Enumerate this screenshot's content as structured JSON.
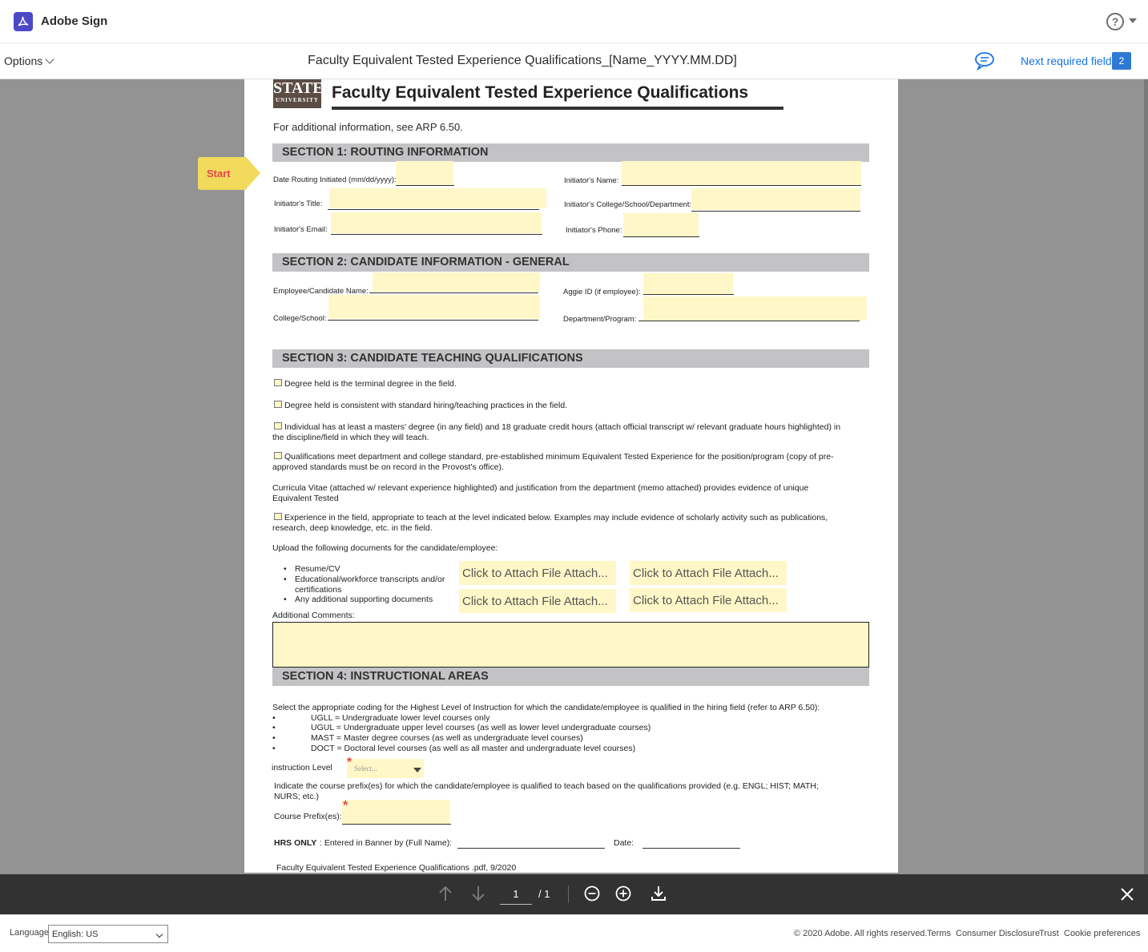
{
  "app": {
    "brand": "Adobe Sign"
  },
  "optionsBar": {
    "options_label": "Options",
    "doc_title": "Faculty Equivalent Tested Experience Qualifications_[Name_YYYY.MM.DD]",
    "next_field_label": "Next required field",
    "next_field_count": "2"
  },
  "form": {
    "logo_big": "STATE",
    "logo_small": "UNIVERSITY",
    "title": "Faculty Equivalent Tested Experience Qualifications",
    "additional_info": "For additional information, see ARP 6.50.",
    "start_tag": "Start",
    "section1": {
      "title": "SECTION 1: ROUTING INFORMATION",
      "date_label": "Date Routing Initiated (mm/dd/yyyy):",
      "initiator_name": "Initiator's Name:",
      "initiator_title": "Initiator's Title:",
      "initiator_college": "Initiator's College/School/Department:",
      "initiator_email": "Initiator's Email:",
      "initiator_phone": "Initiator's Phone:"
    },
    "section2": {
      "title": "SECTION 2: CANDIDATE INFORMATION - GENERAL",
      "candidate_name": "Employee/Candidate Name:",
      "aggie_id": "Aggie ID (if employee):",
      "college": "College/School:",
      "department": "Department/Program:"
    },
    "section3": {
      "title": "SECTION 3: CANDIDATE TEACHING QUALIFICATIONS",
      "opt1": "Degree held is the terminal degree in the field.",
      "opt2": "Degree held is consistent with standard hiring/teaching practices in the field.",
      "opt3a": "Individual has at least a masters' degree (in any field) and 18 graduate credit hours (attach official transcript w/ relevant graduate hours highlighted) in",
      "opt3b": "the discipline/field in which they will teach.",
      "opt4a": "Qualifications meet department and college standard, pre-established minimum Equivalent Tested Experience for the position/program (copy of pre-",
      "opt4b": "approved standards must be on record in the Provost's office).",
      "cv_a": "Curricula Vitae (attached w/ relevant experience highlighted) and justification from the department (memo attached) provides evidence of unique",
      "cv_b": "Equivalent Tested",
      "opt5a": "Experience in the field, appropriate to teach at the level indicated below. Examples may include evidence of scholarly activity such as publications,",
      "opt5b": "research, deep knowledge, etc. in the field.",
      "upload_intro": "Upload the following documents for the candidate/employee:",
      "docs": [
        "Resume/CV",
        "Educational/workforce transcripts and/or",
        "certifications",
        "Any additional supporting documents"
      ],
      "attach_label": "Click to Attach File Attach...",
      "comments_label": "Additional Comments:"
    },
    "section4": {
      "title": "SECTION 4: INSTRUCTIONAL AREAS",
      "intro": "Select the appropriate coding for the Highest Level of Instruction for which the candidate/employee is qualified in the hiring field (refer to ARP 6.50):",
      "codes": [
        "UGLL = Undergraduate lower level courses only",
        "UGUL = Undergraduate upper level courses (as well as lower level undergraduate courses)",
        "MAST = Master degree courses (as well as undergraduate level courses)",
        "DOCT = Doctoral level courses (as well as all master and undergraduate level courses)"
      ],
      "bullet": "•",
      "instruction_label": "instruction Level",
      "select_placeholder": "Select...",
      "prefix_a": "Indicate the course prefix(es) for which the candidate/employee is qualified to teach based on the qualifications provided (e.g. ENGL; HIST; MATH;",
      "prefix_b": "NURS; etc.)",
      "prefix_label": "Course Prefix(es):",
      "required_mark": "*",
      "hrs_only": "HRS ONLY",
      "hrs_text": ":  Entered in Banner by (Full Name):",
      "date_label": "Date:",
      "footer_note": "Faculty Equivalent Tested Experience Qualifications .pdf, 9/2020"
    }
  },
  "toolbar": {
    "page_current": "1",
    "page_total": "/ 1"
  },
  "footer": {
    "language_label": "Language",
    "language_value": "English: US",
    "copyright": "© 2020 Adobe. All rights reserved.",
    "terms": "Terms",
    "consumer": "Consumer Disclosure",
    "trust": "Trust",
    "cookies": "Cookie preferences"
  },
  "colors": {
    "accent": "#1473e6",
    "field": "#fff7c7",
    "start_tag": "#f1da5c",
    "toolbar": "#323232",
    "viewer_bg": "#939393"
  }
}
